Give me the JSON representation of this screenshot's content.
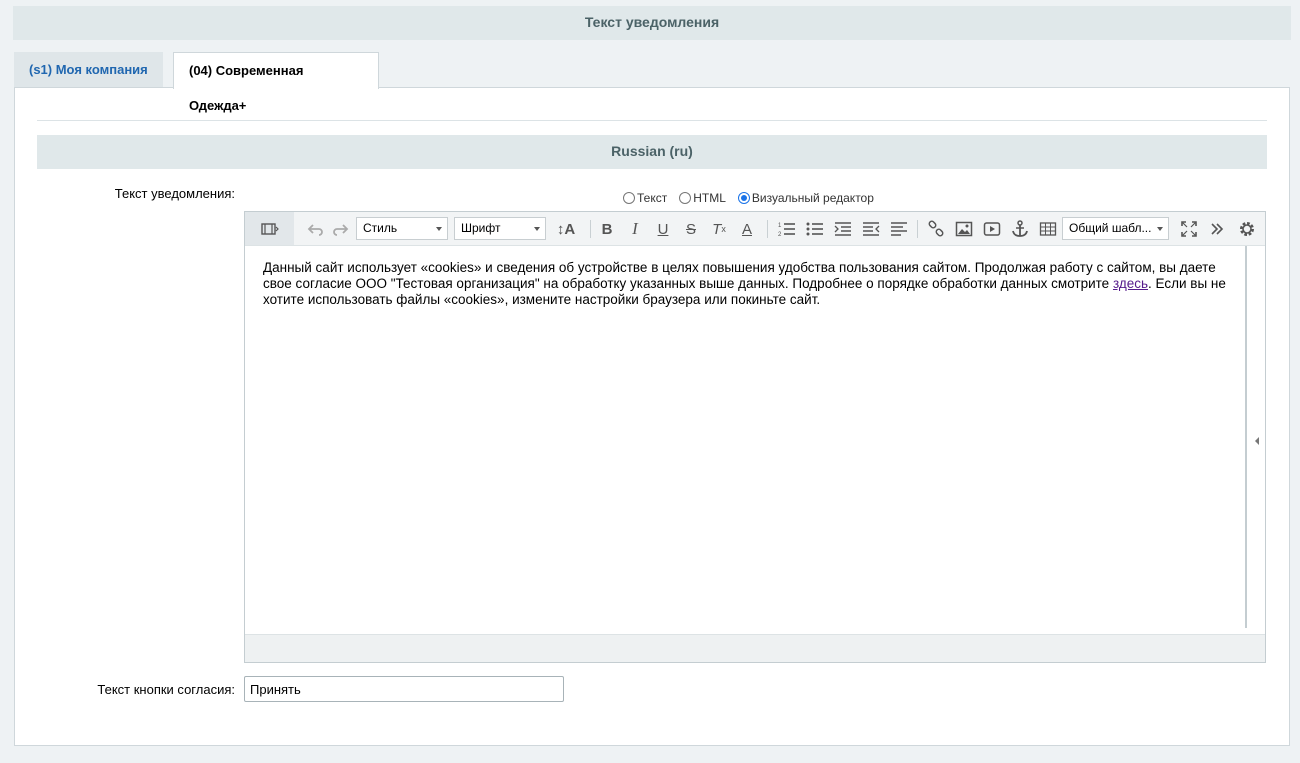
{
  "page": {
    "section_title": "Текст уведомления"
  },
  "tabs": [
    {
      "label": "(s1) Моя компания",
      "active": false
    },
    {
      "label": "(04) Современная Одежда+",
      "active": true
    }
  ],
  "panel": {
    "language_header": "Russian (ru)"
  },
  "form": {
    "notice_label": "Текст уведомления:",
    "accept_label": "Текст кнопки согласия:",
    "accept_value": "Принять"
  },
  "editor_modes": {
    "selected": "visual",
    "options": [
      {
        "id": "text",
        "label": "Текст"
      },
      {
        "id": "html",
        "label": "HTML"
      },
      {
        "id": "visual",
        "label": "Визуальный редактор"
      }
    ]
  },
  "toolbar": {
    "style_select": "Стиль",
    "font_select": "Шрифт",
    "template_select": "Общий шабл..."
  },
  "editor_content": {
    "text_before_link": "Данный сайт использует «cookies» и сведения об устройстве в целях повышения удобства пользования сайтом. Продолжая работу с сайтом, вы даете свое согласие ООО \"Тестовая организация\" на обработку указанных выше данных. Подробнее о порядке обработки данных смотрите ",
    "link_text": "здесь",
    "text_after_link": ". Если вы не хотите использовать файлы «cookies», измените настройки браузера или покиньте сайт."
  },
  "colors": {
    "header_bg": "#e0e8ea",
    "header_text": "#4b6267",
    "tab_link": "#2067b0",
    "link_visited": "#551a8b",
    "radio_accent": "#1a73e8"
  }
}
